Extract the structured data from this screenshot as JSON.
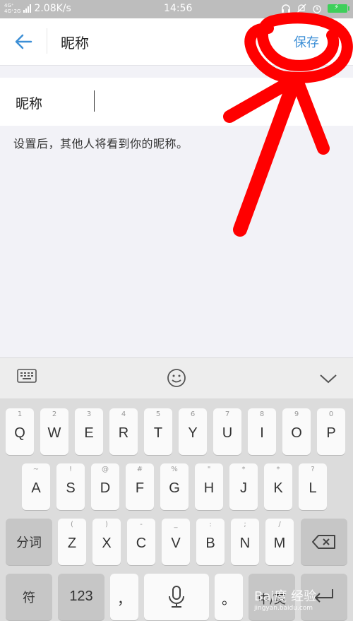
{
  "status_bar": {
    "network_badge_top": "4G⁺",
    "network_badge_bottom": "4G⁺2G",
    "speed": "2.08K/s",
    "time": "14:56"
  },
  "header": {
    "title": "昵称",
    "save_label": "保存"
  },
  "nickname_field": {
    "label": "昵称",
    "value": ""
  },
  "hint_text": "设置后，其他人将看到你的昵称。",
  "keyboard": {
    "row1": [
      {
        "main": "Q",
        "sub": "1"
      },
      {
        "main": "W",
        "sub": "2"
      },
      {
        "main": "E",
        "sub": "3"
      },
      {
        "main": "R",
        "sub": "4"
      },
      {
        "main": "T",
        "sub": "5"
      },
      {
        "main": "Y",
        "sub": "6"
      },
      {
        "main": "U",
        "sub": "7"
      },
      {
        "main": "I",
        "sub": "8"
      },
      {
        "main": "O",
        "sub": "9"
      },
      {
        "main": "P",
        "sub": "0"
      }
    ],
    "row2": [
      {
        "main": "A",
        "sub": "~"
      },
      {
        "main": "S",
        "sub": "!"
      },
      {
        "main": "D",
        "sub": "@"
      },
      {
        "main": "F",
        "sub": "#"
      },
      {
        "main": "G",
        "sub": "%"
      },
      {
        "main": "H",
        "sub": "\""
      },
      {
        "main": "J",
        "sub": "*"
      },
      {
        "main": "K",
        "sub": "*"
      },
      {
        "main": "L",
        "sub": "?"
      }
    ],
    "row3": [
      {
        "main": "Z",
        "sub": "("
      },
      {
        "main": "X",
        "sub": ")"
      },
      {
        "main": "C",
        "sub": "-"
      },
      {
        "main": "V",
        "sub": "_"
      },
      {
        "main": "B",
        "sub": ":"
      },
      {
        "main": "N",
        "sub": ";"
      },
      {
        "main": "M",
        "sub": "/"
      }
    ],
    "segment_key": "分词",
    "symbol_key": "符",
    "number_key": "123",
    "comma_key": "，",
    "period_key": "。",
    "lang_key": "中/英"
  },
  "watermark": {
    "text": "Bai度 经验",
    "url": "jingyan.baidu.com"
  },
  "colors": {
    "accent": "#3d8fd6",
    "annotation": "#ff0000"
  }
}
